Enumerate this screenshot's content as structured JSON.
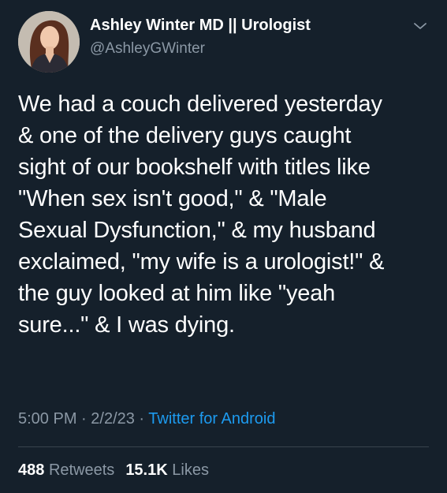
{
  "author": {
    "name": "Ashley Winter MD || Urologist",
    "handle": "@AshleyGWinter",
    "avatar_icon": "profile-photo"
  },
  "menu_icon": "chevron-down-icon",
  "tweet": {
    "lines": [
      "We had a couch delivered yesterday",
      "& one of the delivery guys caught",
      "sight of our bookshelf with titles like",
      "\"When sex isn't good,\" & \"Male",
      "Sexual Dysfunction,\" & my husband",
      "exclaimed, \"my wife is a urologist!\" &",
      "the guy looked at him like \"yeah",
      "sure...\" & I was dying."
    ]
  },
  "meta": {
    "time": "5:00 PM",
    "separator": " · ",
    "date": "2/2/23",
    "source": "Twitter for Android"
  },
  "stats": {
    "retweets_count": "488",
    "retweets_label": "Retweets",
    "likes_count": "15.1K",
    "likes_label": "Likes"
  },
  "colors": {
    "background": "#15202b",
    "text": "#ffffff",
    "secondary": "#8b98a5",
    "link": "#1d9bf0",
    "divider": "#38444d"
  }
}
